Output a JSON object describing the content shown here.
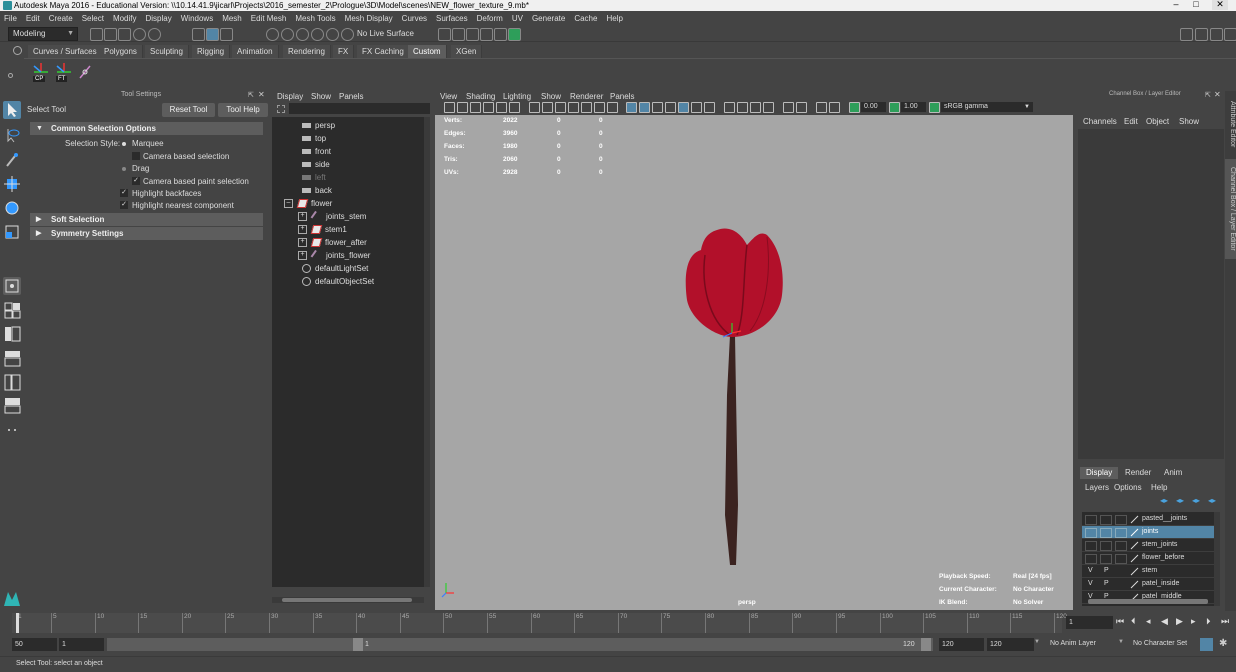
{
  "window": {
    "title": "Autodesk Maya 2016 - Educational Version: \\\\10.14.41.9\\jicarl\\Projects\\2016_semester_2\\Prologue\\3D\\Model\\scenes\\NEW_flower_texture_9.mb*",
    "minimize": "–",
    "maximize": "□",
    "close": "✕"
  },
  "menubar": [
    "File",
    "Edit",
    "Create",
    "Select",
    "Modify",
    "Display",
    "Windows",
    "Mesh",
    "Edit Mesh",
    "Mesh Tools",
    "Mesh Display",
    "Curves",
    "Surfaces",
    "Deform",
    "UV",
    "Generate",
    "Cache",
    "Help"
  ],
  "statusline": {
    "mode": "Modeling",
    "live_surface": "No Live Surface"
  },
  "shelf": {
    "tabs": [
      "Curves / Surfaces",
      "Polygons",
      "Sculpting",
      "Rigging",
      "Animation",
      "Rendering",
      "FX",
      "FX Caching",
      "Custom",
      "XGen"
    ],
    "active_tab": "Custom",
    "items": [
      "CP",
      "FT"
    ]
  },
  "tool_settings": {
    "header": "Tool Settings",
    "tool_name": "Select Tool",
    "reset_button": "Reset Tool",
    "help_button": "Tool Help",
    "sections": {
      "common": "Common Selection Options",
      "soft": "Soft Selection",
      "symmetry": "Symmetry Settings"
    },
    "selection_style_label": "Selection Style:",
    "marquee": "Marquee",
    "camera_based_selection": "Camera based selection",
    "drag": "Drag",
    "camera_based_paint": "Camera based paint selection",
    "highlight_backfaces": "Highlight backfaces",
    "highlight_nearest": "Highlight nearest component"
  },
  "outliner": {
    "menu": [
      "Display",
      "Show",
      "Panels"
    ],
    "items": [
      {
        "label": "persp",
        "type": "camera"
      },
      {
        "label": "top",
        "type": "camera"
      },
      {
        "label": "front",
        "type": "camera"
      },
      {
        "label": "side",
        "type": "camera"
      },
      {
        "label": "left",
        "type": "camera"
      },
      {
        "label": "back",
        "type": "camera"
      },
      {
        "label": "flower",
        "type": "transform"
      },
      {
        "label": "joints_stem",
        "type": "joint"
      },
      {
        "label": "stem1",
        "type": "transform"
      },
      {
        "label": "flower_after",
        "type": "transform"
      },
      {
        "label": "joints_flower",
        "type": "joint"
      },
      {
        "label": "defaultLightSet",
        "type": "set"
      },
      {
        "label": "defaultObjectSet",
        "type": "set"
      }
    ]
  },
  "viewport": {
    "menu": [
      "View",
      "Shading",
      "Lighting",
      "Show",
      "Renderer",
      "Panels"
    ],
    "near_value": "0.00",
    "far_value": "1.00",
    "color_space": "sRGB gamma",
    "hud_stats": [
      {
        "label": "Verts:",
        "a": "2022",
        "b": "0",
        "c": "0"
      },
      {
        "label": "Edges:",
        "a": "3960",
        "b": "0",
        "c": "0"
      },
      {
        "label": "Faces:",
        "a": "1980",
        "b": "0",
        "c": "0"
      },
      {
        "label": "Tris:",
        "a": "2060",
        "b": "0",
        "c": "0"
      },
      {
        "label": "UVs:",
        "a": "2928",
        "b": "0",
        "c": "0"
      }
    ],
    "camera_label": "persp",
    "hud_info": [
      {
        "label": "Playback Speed:",
        "value": "Real [24 fps]"
      },
      {
        "label": "Current Character:",
        "value": "No Character"
      },
      {
        "label": "IK Blend:",
        "value": "No Solver"
      }
    ],
    "colors": {
      "petal": "#b2102a",
      "stem": "#3b2320",
      "background": "#a6a6a6"
    }
  },
  "channel_box": {
    "header": "Channel Box / Layer Editor",
    "menu": [
      "Channels",
      "Edit",
      "Object",
      "Show"
    ],
    "layer_tabs": [
      "Display",
      "Render",
      "Anim"
    ],
    "active_layer_tab": "Display",
    "layer_menu": [
      "Layers",
      "Options",
      "Help"
    ],
    "layers": [
      {
        "v": "",
        "p": "",
        "name": "pasted__joints",
        "selected": false
      },
      {
        "v": "",
        "p": "",
        "name": "joints",
        "selected": true
      },
      {
        "v": "",
        "p": "",
        "name": "stem_joints",
        "selected": false
      },
      {
        "v": "",
        "p": "",
        "name": "flower_before",
        "selected": false
      },
      {
        "v": "V",
        "p": "P",
        "name": "stem",
        "selected": false
      },
      {
        "v": "V",
        "p": "P",
        "name": "patel_inside",
        "selected": false
      },
      {
        "v": "V",
        "p": "P",
        "name": "patel_middle",
        "selected": false
      }
    ]
  },
  "side_tabs": [
    "Attribute Editor",
    "Channel Box / Layer Editor"
  ],
  "timeline": {
    "ticks": [
      "1",
      "5",
      "10",
      "15",
      "20",
      "25",
      "30",
      "35",
      "40",
      "45",
      "50",
      "55",
      "60",
      "65",
      "70",
      "75",
      "80",
      "85",
      "90",
      "95",
      "100",
      "105",
      "110",
      "115",
      "120"
    ],
    "current_frame": "1"
  },
  "range": {
    "start": "50",
    "inner_start": "1",
    "slider_start": "1",
    "slider_end": "120",
    "inner_end": "120",
    "end": "120",
    "anim_layer": "No Anim Layer",
    "character_set": "No Character Set"
  },
  "help_line": "Select Tool: select an object"
}
